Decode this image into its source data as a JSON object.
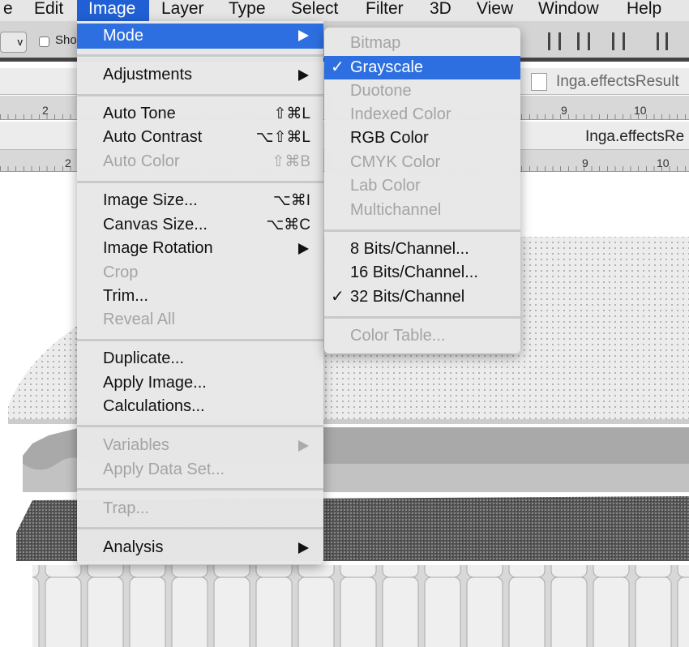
{
  "menubar": {
    "items": [
      "e",
      "Edit",
      "Image",
      "Layer",
      "Type",
      "Select",
      "Filter",
      "3D",
      "View",
      "Window",
      "Help"
    ],
    "active": "Image"
  },
  "toolbar": {
    "checkbox_label": "Sho",
    "select_chevron": "v"
  },
  "documents": {
    "tab1": "Inga.effectsResult",
    "tab2": "Inga.effectsRe",
    "ruler_labels": [
      "2",
      "9",
      "10"
    ]
  },
  "image_menu": {
    "items": [
      {
        "label": "Mode",
        "submenu": true,
        "highlighted": true
      },
      {
        "label": "Adjustments",
        "submenu": true
      },
      {
        "label": "Auto Tone",
        "shortcut": "⇧⌘L"
      },
      {
        "label": "Auto Contrast",
        "shortcut": "⌥⇧⌘L"
      },
      {
        "label": "Auto Color",
        "shortcut": "⇧⌘B",
        "disabled": true
      },
      {
        "label": "Image Size...",
        "shortcut": "⌥⌘I"
      },
      {
        "label": "Canvas Size...",
        "shortcut": "⌥⌘C"
      },
      {
        "label": "Image Rotation",
        "submenu": true
      },
      {
        "label": "Crop",
        "disabled": true
      },
      {
        "label": "Trim..."
      },
      {
        "label": "Reveal All",
        "disabled": true
      },
      {
        "label": "Duplicate..."
      },
      {
        "label": "Apply Image..."
      },
      {
        "label": "Calculations..."
      },
      {
        "label": "Variables",
        "submenu": true,
        "disabled": true
      },
      {
        "label": "Apply Data Set...",
        "disabled": true
      },
      {
        "label": "Trap...",
        "disabled": true
      },
      {
        "label": "Analysis",
        "submenu": true
      }
    ]
  },
  "mode_submenu": {
    "items": [
      {
        "label": "Bitmap",
        "disabled": true
      },
      {
        "label": "Grayscale",
        "checked": true,
        "highlighted": true
      },
      {
        "label": "Duotone",
        "disabled": true
      },
      {
        "label": "Indexed Color",
        "disabled": true
      },
      {
        "label": "RGB Color"
      },
      {
        "label": "CMYK Color",
        "disabled": true
      },
      {
        "label": "Lab Color",
        "disabled": true
      },
      {
        "label": "Multichannel",
        "disabled": true
      },
      {
        "label": "8 Bits/Channel..."
      },
      {
        "label": "16 Bits/Channel..."
      },
      {
        "label": "32 Bits/Channel",
        "checked": true
      },
      {
        "label": "Color Table...",
        "disabled": true
      }
    ],
    "checkmark": "✓"
  },
  "colors": {
    "highlight": "#2d6fe0",
    "menubar_active": "#2160d4"
  }
}
